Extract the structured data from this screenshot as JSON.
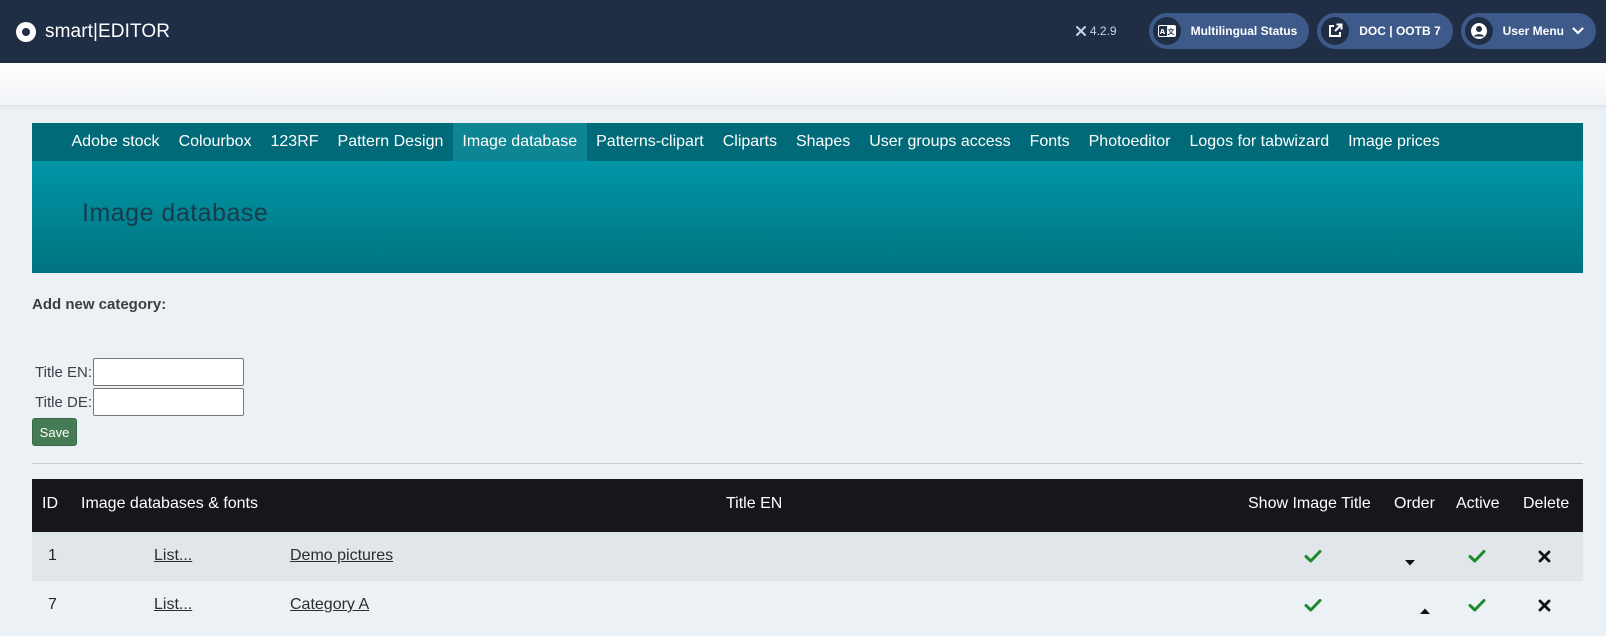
{
  "header": {
    "brand": "smart|EDITOR",
    "version": "4.2.9",
    "multilingual_label": "Multilingual Status",
    "doc_label": "DOC | OOTB 7",
    "user_menu_label": "User Menu"
  },
  "tabs": [
    {
      "label": "Adobe stock"
    },
    {
      "label": "Colourbox"
    },
    {
      "label": "123RF"
    },
    {
      "label": "Pattern Design"
    },
    {
      "label": "Image database",
      "active": true
    },
    {
      "label": "Patterns-clipart"
    },
    {
      "label": "Cliparts"
    },
    {
      "label": "Shapes"
    },
    {
      "label": "User groups access"
    },
    {
      "label": "Fonts"
    },
    {
      "label": "Photoeditor"
    },
    {
      "label": "Logos for tabwizard"
    },
    {
      "label": "Image prices"
    }
  ],
  "page": {
    "title": "Image database"
  },
  "form": {
    "heading": "Add new category:",
    "title_en_label": "Title EN:",
    "title_en_value": "",
    "title_de_label": "Title DE:",
    "title_de_value": "",
    "save_label": "Save"
  },
  "table": {
    "headers": {
      "id": "ID",
      "databases": "Image databases & fonts",
      "title_en": "Title EN",
      "show_title": "Show Image Title",
      "order": "Order",
      "active": "Active",
      "delete": "Delete"
    },
    "rows": [
      {
        "id": "1",
        "list_link": "List...",
        "title": "Demo pictures",
        "show_title": "check",
        "order": "down",
        "active": "check",
        "delete": "x"
      },
      {
        "id": "7",
        "list_link": "List...",
        "title": "Category A",
        "show_title": "check",
        "order": "up",
        "active": "check",
        "delete": "x"
      }
    ]
  },
  "colors": {
    "header_bg": "#1f2d45",
    "pill_bg": "#3d5a8a",
    "tabs_bg": "#006a78",
    "hero_bg": "#0096a7",
    "save_bg": "#457b55",
    "table_head_bg": "#17171b",
    "check_green": "#1e8a2e"
  },
  "icons": {
    "brand": "circle-dot-icon",
    "version": "joomla-icon",
    "multilingual": "translate-icon",
    "doc": "external-link-icon",
    "user": "user-circle-icon",
    "user_chevron": "chevron-down-icon",
    "show_title": "check-icon",
    "active": "check-icon",
    "delete": "close-icon",
    "order_down": "caret-down-icon",
    "order_up": "caret-up-icon"
  }
}
